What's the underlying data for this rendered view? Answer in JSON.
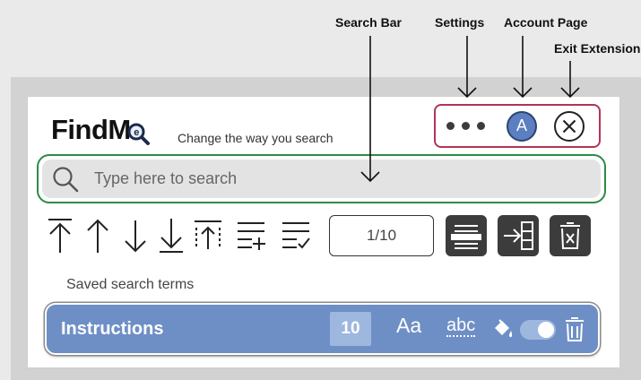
{
  "annotations": {
    "search_bar": "Search Bar",
    "settings": "Settings",
    "account_page": "Account Page",
    "exit_extension": "Exit Extension"
  },
  "header": {
    "logo_text": "FindM",
    "tagline": "Change the way you search",
    "account_initial": "A"
  },
  "search": {
    "placeholder": "Type here to search"
  },
  "toolbar": {
    "counter": "1/10",
    "icons": [
      "jump-to-first-icon",
      "previous-match-icon",
      "next-match-icon",
      "jump-to-last-icon",
      "select-all-matches-icon",
      "add-search-term-icon",
      "saved-terms-icon"
    ]
  },
  "saved": {
    "label": "Saved search terms",
    "items": [
      {
        "term": "Instructions",
        "count": "10",
        "case_label": "Aa",
        "word_label": "abc",
        "enabled": true
      }
    ]
  },
  "colors": {
    "accent": "#6e8fc6",
    "controls_border": "#b03556",
    "search_border": "#2e8b45",
    "avatar": "#5b7fc0"
  }
}
